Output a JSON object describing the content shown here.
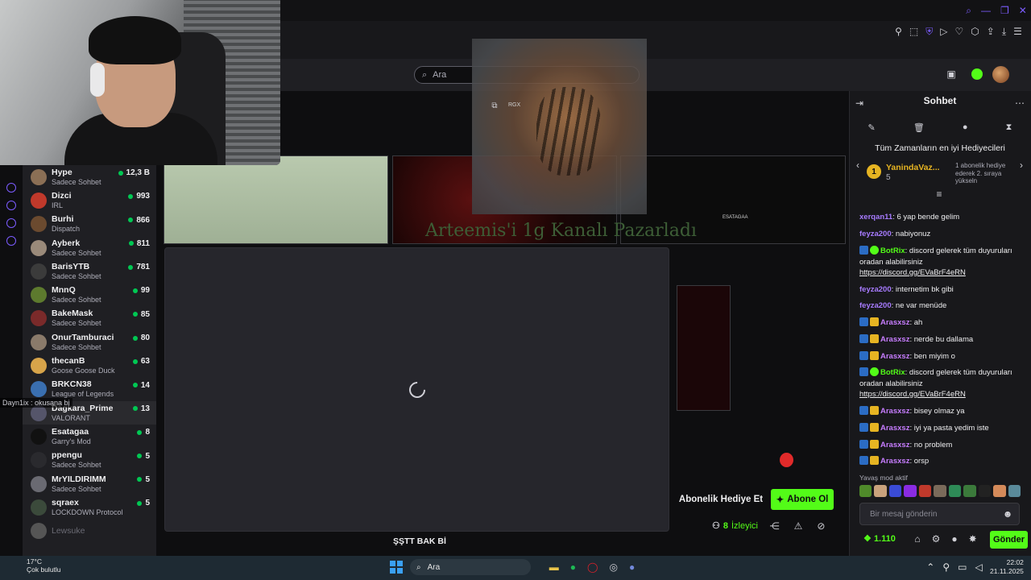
{
  "search": {
    "placeholder": "Ara"
  },
  "overlay": {
    "rgx_label": "RGX",
    "stream_text": "Arteemis'i 1g Kanalı Pazarladı",
    "tile_label": "ESATAGAA"
  },
  "sidebar": {
    "tooltip": "Dayn1ix : okusana bi",
    "channels": [
      {
        "name": "Hype",
        "category": "Sadece Sohbet",
        "viewers": "12,3 B",
        "color": "#8b6f55"
      },
      {
        "name": "Dizci",
        "category": "IRL",
        "viewers": "993",
        "color": "#c0392b"
      },
      {
        "name": "Burhi",
        "category": "Dispatch",
        "viewers": "866",
        "color": "#6b4a2f"
      },
      {
        "name": "Ayberk",
        "category": "Sadece Sohbet",
        "viewers": "811",
        "color": "#9a8a7a"
      },
      {
        "name": "BarisYTB",
        "category": "Sadece Sohbet",
        "viewers": "781",
        "color": "#3b3b3b"
      },
      {
        "name": "MnnQ",
        "category": "Sadece Sohbet",
        "viewers": "99",
        "color": "#5d7a2e"
      },
      {
        "name": "BakeMask",
        "category": "Sadece Sohbet",
        "viewers": "85",
        "color": "#7a2a2a"
      },
      {
        "name": "OnurTamburaci",
        "category": "Sadece Sohbet",
        "viewers": "80",
        "color": "#8a7a6a"
      },
      {
        "name": "thecanB",
        "category": "Goose Goose Duck",
        "viewers": "63",
        "color": "#d7a44a"
      },
      {
        "name": "BRKCN38",
        "category": "League of Legends",
        "viewers": "14",
        "color": "#3a6fb0"
      },
      {
        "name": "Dagkara_Prime",
        "category": "VALORANT",
        "viewers": "13",
        "color": "#55556a"
      },
      {
        "name": "Esatagaa",
        "category": "Garry's Mod",
        "viewers": "8",
        "color": "#111111"
      },
      {
        "name": "ppengu",
        "category": "Sadece Sohbet",
        "viewers": "5",
        "color": "#2a2a2e"
      },
      {
        "name": "MrYILDIRIMM",
        "category": "Sadece Sohbet",
        "viewers": "5",
        "color": "#6a6a72"
      },
      {
        "name": "sqraex",
        "category": "LOCKDOWN Protocol",
        "viewers": "5",
        "color": "#3b4a3b"
      },
      {
        "name": "Lewsuke",
        "category": "",
        "viewers": "",
        "color": "#555555"
      }
    ]
  },
  "player": {
    "title": "ŞŞTT BAK Bİ"
  },
  "actions": {
    "gift_label": "Abonelik Hediye Et",
    "subscribe_label": "Abone Ol",
    "viewer_count": "8",
    "viewer_label": "İzleyici"
  },
  "chat": {
    "title": "Sohbet",
    "top_gifters_title": "Tüm Zamanların en iyi Hediyecileri",
    "top_gifter": {
      "rank": "1",
      "name": "YanindaVaz...",
      "count": "5",
      "note": "1 abonelik hediye ederek 2. sıraya yükseln"
    },
    "messages": [
      {
        "user": "xerqan11",
        "text": "6 yap bende gelim",
        "color": "#a77bff",
        "badges": []
      },
      {
        "user": "feyza200",
        "text": "nabiyonuz",
        "color": "#a77bff",
        "badges": []
      },
      {
        "user": "BotRix",
        "text": "discord gelerek tüm duyuruları oradan alabilirsiniz",
        "link": "https://discord.gg/EVaBrF4eRN",
        "color": "#53fc18",
        "badges": [
          "mod",
          "verified"
        ]
      },
      {
        "user": "feyza200",
        "text": "internetim bk gibi",
        "color": "#a77bff",
        "badges": []
      },
      {
        "user": "feyza200",
        "text": "ne var menüde",
        "color": "#a77bff",
        "badges": []
      },
      {
        "user": "Arasxsz",
        "text": "ah",
        "color": "#c77dff",
        "badges": [
          "mod",
          "crown"
        ]
      },
      {
        "user": "Arasxsz",
        "text": "nerde bu dallama",
        "color": "#c77dff",
        "badges": [
          "mod",
          "crown"
        ]
      },
      {
        "user": "Arasxsz",
        "text": "ben miyim o",
        "color": "#c77dff",
        "badges": [
          "mod",
          "crown"
        ]
      },
      {
        "user": "BotRix",
        "text": "discord gelerek tüm duyuruları oradan alabilirsiniz",
        "link": "https://discord.gg/EVaBrF4eRN",
        "color": "#53fc18",
        "badges": [
          "mod",
          "verified"
        ]
      },
      {
        "user": "Arasxsz",
        "text": "bisey olmaz ya",
        "color": "#c77dff",
        "badges": [
          "mod",
          "crown"
        ]
      },
      {
        "user": "Arasxsz",
        "text": "iyi ya pasta yedim iste",
        "color": "#c77dff",
        "badges": [
          "mod",
          "crown"
        ]
      },
      {
        "user": "Arasxsz",
        "text": "no problem",
        "color": "#c77dff",
        "badges": [
          "mod",
          "crown"
        ]
      },
      {
        "user": "Arasxsz",
        "text": "orsp",
        "color": "#c77dff",
        "badges": [
          "mod",
          "crown"
        ]
      }
    ],
    "slow_mode": "Yavaş mod aktif",
    "input_placeholder": "Bir mesaj gönderin",
    "points": "1.110",
    "send_label": "Gönder"
  },
  "taskbar": {
    "temperature": "17°C",
    "weather": "Çok bulutlu",
    "search_placeholder": "Ara",
    "time": "22:02",
    "date": "21.11.2025"
  }
}
